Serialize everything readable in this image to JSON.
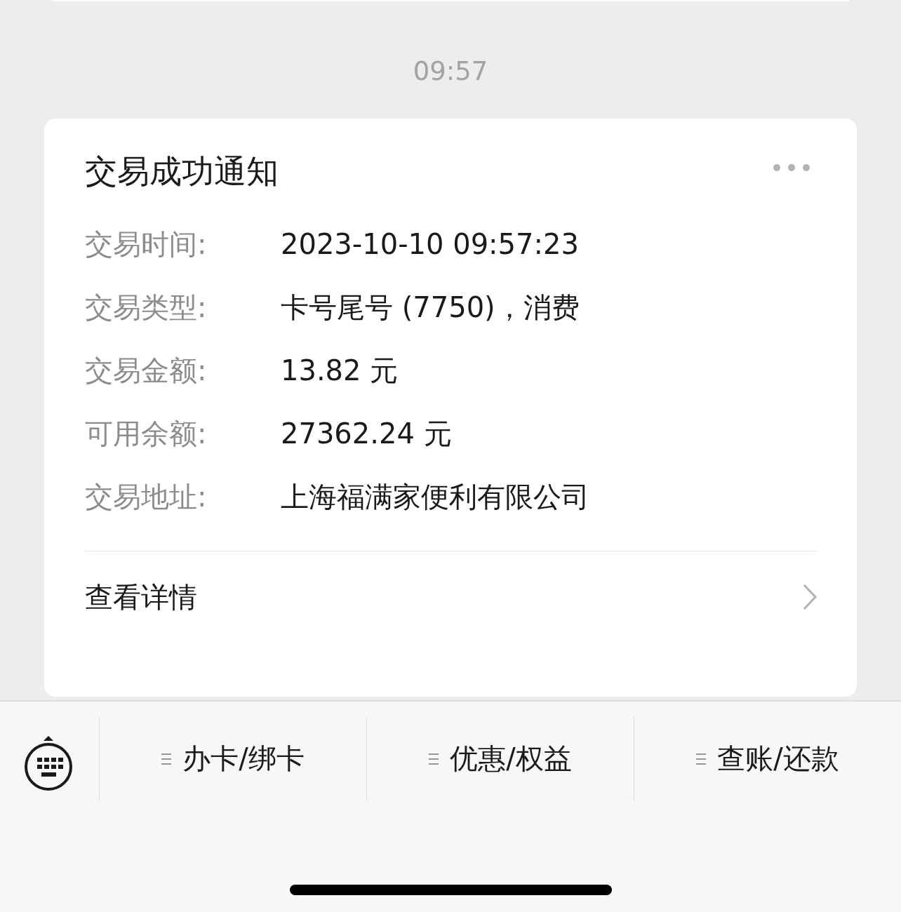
{
  "timestamp": "09:57",
  "card": {
    "title": "交易成功通知",
    "fields": [
      {
        "label": "交易时间:",
        "value": "2023-10-10 09:57:23"
      },
      {
        "label": "交易类型:",
        "value": "卡号尾号 (7750)，消费"
      },
      {
        "label": "交易金额:",
        "value": "13.82 元"
      },
      {
        "label": "可用余额:",
        "value": "27362.24 元"
      },
      {
        "label": "交易地址:",
        "value": "上海福满家便利有限公司"
      }
    ],
    "link": "查看详情"
  },
  "menu": {
    "items": [
      {
        "label": "办卡/绑卡"
      },
      {
        "label": "优惠/权益"
      },
      {
        "label": "查账/还款"
      }
    ]
  }
}
